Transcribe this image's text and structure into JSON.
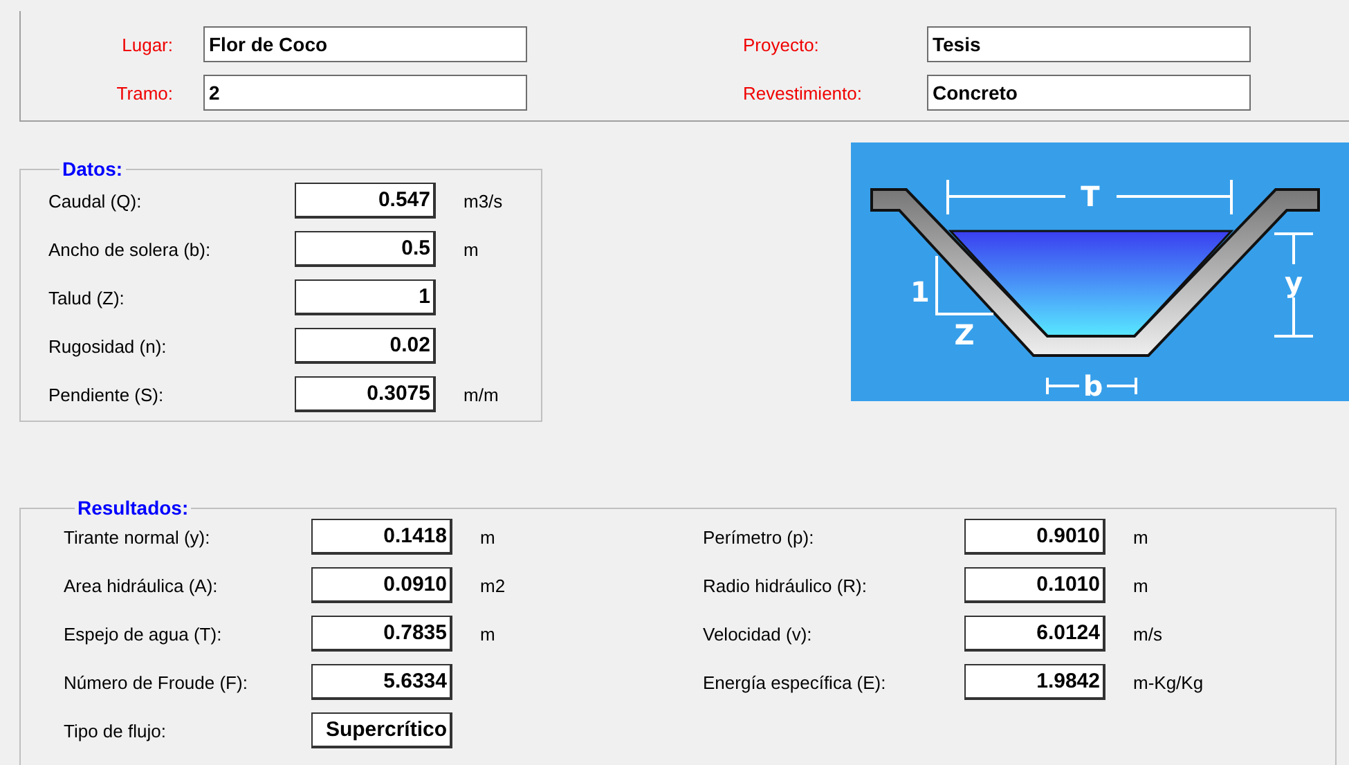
{
  "header": {
    "left": [
      {
        "label": "Lugar:",
        "value": "Flor de Coco"
      },
      {
        "label": "Tramo:",
        "value": "2"
      }
    ],
    "right": [
      {
        "label": "Proyecto:",
        "value": "Tesis"
      },
      {
        "label": "Revestimiento:",
        "value": "Concreto"
      }
    ]
  },
  "datos": {
    "title": "Datos:",
    "items": [
      {
        "label": "Caudal (Q):",
        "value": "0.547",
        "unit": "m3/s"
      },
      {
        "label": "Ancho de solera (b):",
        "value": "0.5",
        "unit": "m"
      },
      {
        "label": "Talud (Z):",
        "value": "1"
      },
      {
        "label": "Rugosidad (n):",
        "value": "0.02"
      },
      {
        "label": "Pendiente (S):",
        "value": "0.3075",
        "unit": "m/m"
      }
    ]
  },
  "diagram": {
    "top_width": "T",
    "slope_rise": "1",
    "depth": "y",
    "slope_run": "Z",
    "bottom_width": "b"
  },
  "resultados": {
    "title": "Resultados:",
    "left": [
      {
        "label": "Tirante normal (y):",
        "value": "0.1418",
        "unit": "m"
      },
      {
        "label": "Area hidráulica (A):",
        "value": "0.0910",
        "unit": "m2"
      },
      {
        "label": "Espejo de agua (T):",
        "value": "0.7835",
        "unit": "m"
      },
      {
        "label": "Número de Froude (F):",
        "value": "5.6334"
      },
      {
        "label": "Tipo de flujo:",
        "value": "Supercrítico"
      }
    ],
    "right": [
      {
        "label": "Perímetro (p):",
        "value": "0.9010",
        "unit": "m"
      },
      {
        "label": "Radio hidráulico (R):",
        "value": "0.1010",
        "unit": "m"
      },
      {
        "label": "Velocidad (v):",
        "value": "6.0124",
        "unit": "m/s"
      },
      {
        "label": "Energía específica (E):",
        "value": "1.9842",
        "unit": "m-Kg/Kg"
      }
    ]
  }
}
